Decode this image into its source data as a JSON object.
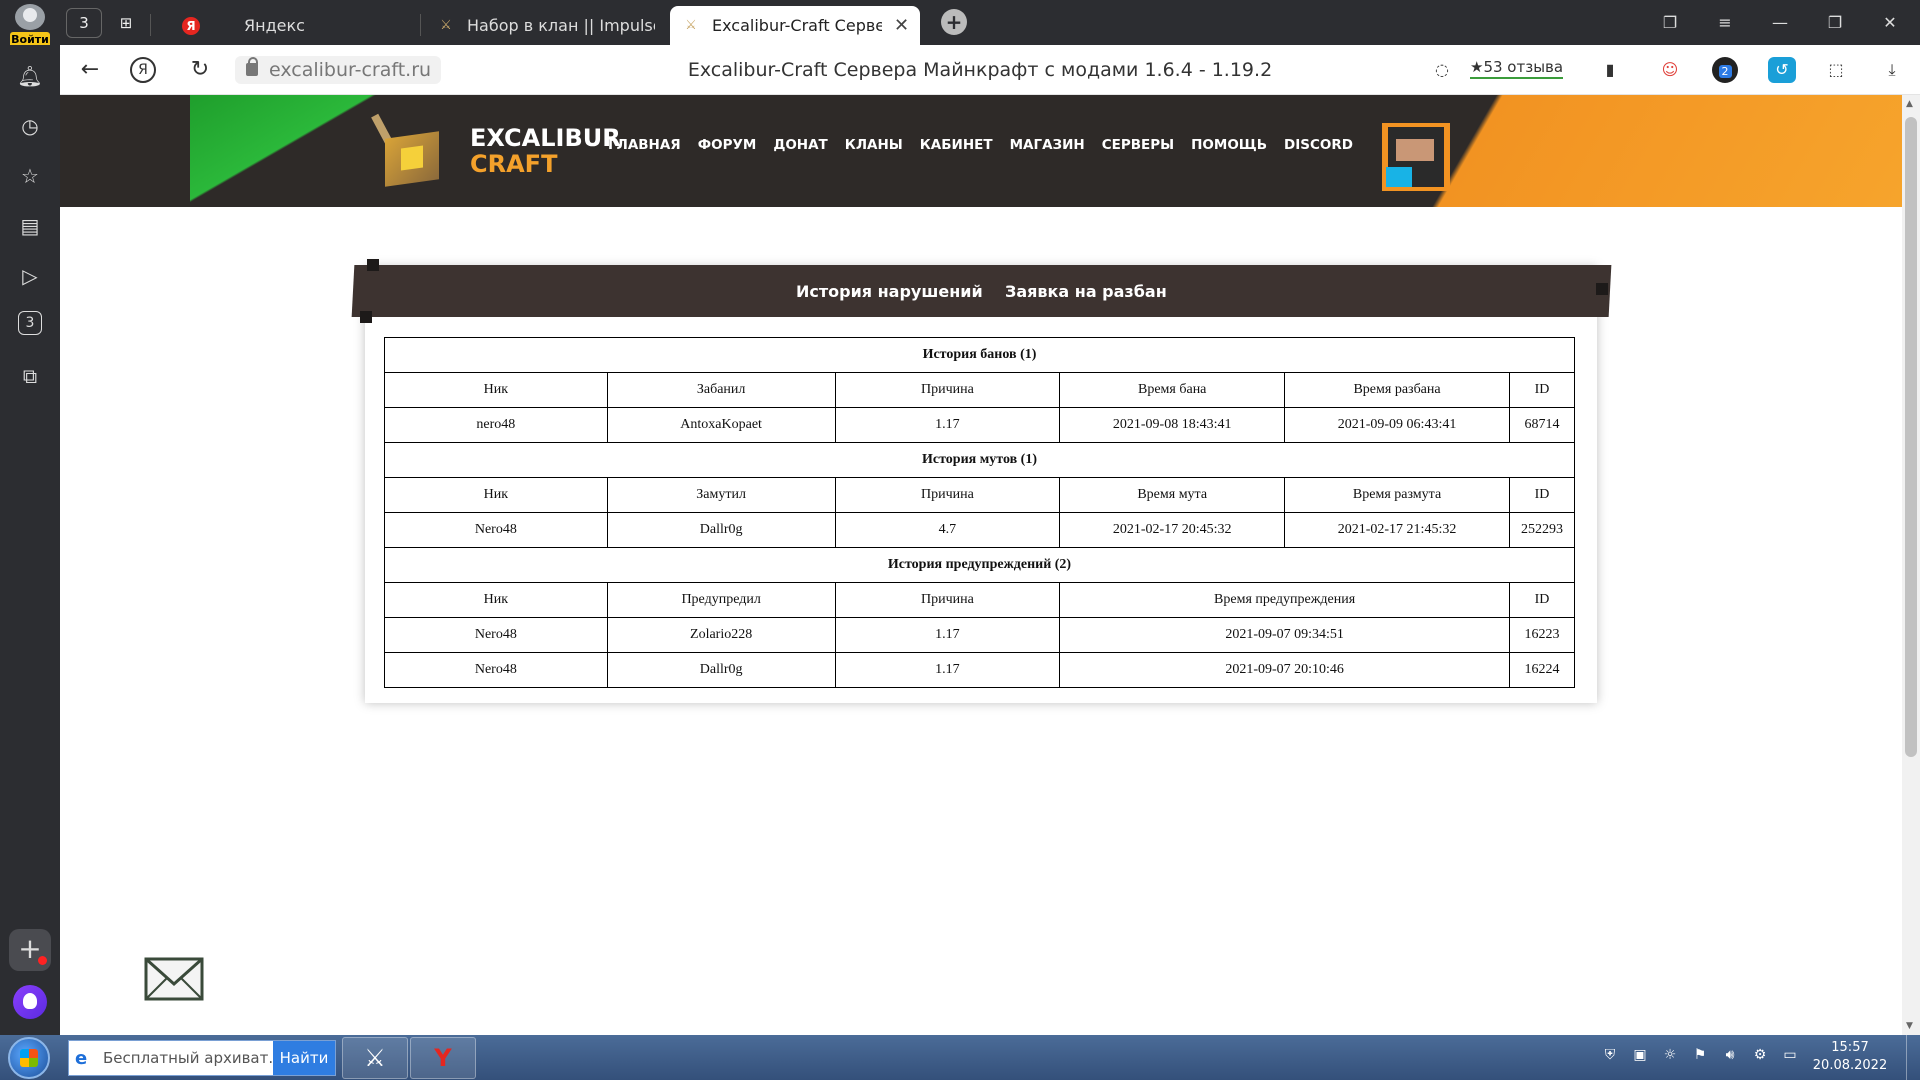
{
  "browser": {
    "profile_login": "Войти",
    "tab_counter": "3",
    "tabs": [
      {
        "title": "Яндекс"
      },
      {
        "title": "Набор в клан || Impulse - I"
      },
      {
        "title": "Excalibur-Craft Сервера"
      }
    ],
    "address": {
      "url": "excalibur-craft.ru",
      "page_title": "Excalibur-Craft Сервера Майнкрафт с модами 1.6.4 - 1.19.2",
      "reviews": "★53 отзыва"
    },
    "sidebar_counter": "3",
    "extension_badge": "2"
  },
  "site": {
    "logo_line1": "EXCALIBUR",
    "logo_line2": "CRAFT",
    "nav": [
      "ГЛАВНАЯ",
      "ФОРУМ",
      "ДОНАТ",
      "КЛАНЫ",
      "КАБИНЕТ",
      "МАГАЗИН",
      "СЕРВЕРЫ",
      "ПОМОЩЬ",
      "DISCORD"
    ],
    "tabs": [
      "История нарушений",
      "Заявка на разбан"
    ]
  },
  "violations": {
    "bans": {
      "title": "История банов (1)",
      "headers": [
        "Ник",
        "Забанил",
        "Причина",
        "Время бана",
        "Время разбана",
        "ID"
      ],
      "rows": [
        [
          "nero48",
          "AntoxaKopaet",
          "1.17",
          "2021-09-08 18:43:41",
          "2021-09-09 06:43:41",
          "68714"
        ]
      ]
    },
    "mutes": {
      "title": "История мутов (1)",
      "headers": [
        "Ник",
        "Замутил",
        "Причина",
        "Время мута",
        "Время размута",
        "ID"
      ],
      "rows": [
        [
          "Nero48",
          "Dallr0g",
          "4.7",
          "2021-02-17 20:45:32",
          "2021-02-17 21:45:32",
          "252293"
        ]
      ]
    },
    "warnings": {
      "title": "История предупреждений (2)",
      "headers": [
        "Ник",
        "Предупредил",
        "Причина",
        "Время предупреждения",
        "ID"
      ],
      "rows": [
        [
          "Nero48",
          "Zolario228",
          "1.17",
          "2021-09-07 09:34:51",
          "16223"
        ],
        [
          "Nero48",
          "Dallr0g",
          "1.17",
          "2021-09-07 20:10:46",
          "16224"
        ]
      ]
    }
  },
  "taskbar": {
    "search_text": "Бесплатный архиват...",
    "search_button": "Найти",
    "time": "15:57",
    "date": "20.08.2022"
  },
  "colors": {
    "header_bg": "#2e2a28",
    "green_accent": "#2bb83a",
    "orange_accent": "#f29322",
    "tabs_bar": "#3d3330"
  }
}
